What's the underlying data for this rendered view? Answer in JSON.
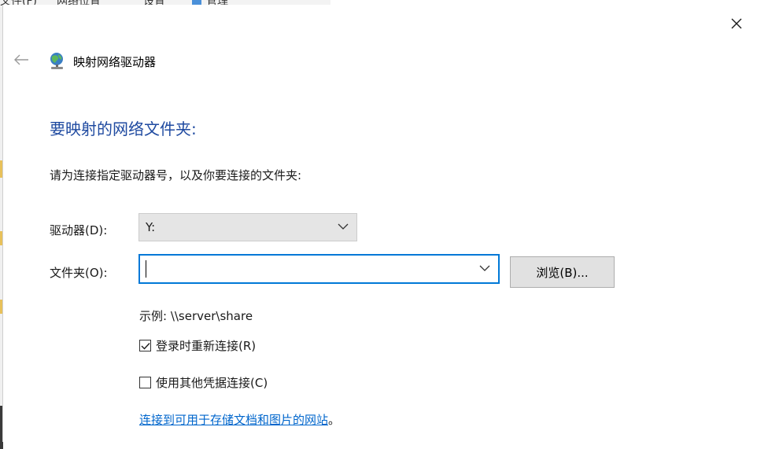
{
  "background": {
    "tabs": [
      "文件(F)",
      "网络位置",
      "设置",
      "管理"
    ]
  },
  "dialog": {
    "title": "映射网络驱动器",
    "heading": "要映射的网络文件夹:",
    "instruction": "请为连接指定驱动器号，以及你要连接的文件夹:",
    "drive": {
      "label": "驱动器(D):",
      "value": "Y:"
    },
    "folder": {
      "label": "文件夹(O):",
      "value": ""
    },
    "browse_label": "浏览(B)...",
    "example": "示例: \\\\server\\share",
    "reconnect": {
      "label": "登录时重新连接(R)",
      "checked": true
    },
    "other_credentials": {
      "label": "使用其他凭据连接(C)",
      "checked": false
    },
    "link_text": "连接到可用于存储文档和图片的网站",
    "link_suffix": "。"
  },
  "icons": {
    "back": "back-arrow-icon",
    "close": "close-icon",
    "title": "network-drive-icon",
    "dropdown": "chevron-down-icon",
    "check": "checkmark-icon"
  },
  "colors": {
    "heading": "#1f4aa0",
    "link": "#0066cc",
    "focus_border": "#0078d7"
  }
}
